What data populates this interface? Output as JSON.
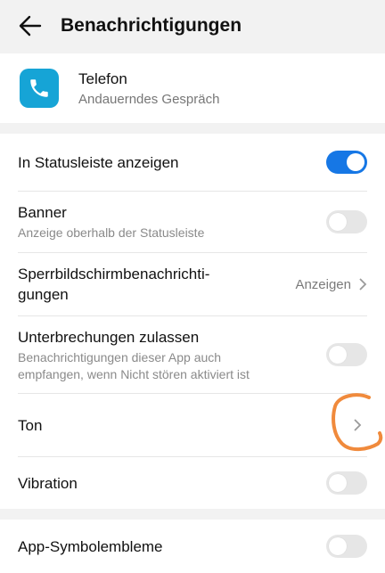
{
  "header": {
    "title": "Benachrichtigungen",
    "back_icon": "arrow-left-icon"
  },
  "app": {
    "name": "Telefon",
    "subtitle": "Andauerndes Gespräch",
    "icon": "phone-icon",
    "icon_color": "#16a4d6"
  },
  "settings": [
    {
      "label": "In Statusleiste anzeigen",
      "toggle": true
    },
    {
      "label": "Banner",
      "sub": "Anzeige oberhalb der Statusleiste",
      "toggle": false
    },
    {
      "label": "Sperrbildschirmbenachrichti-\ngungen",
      "value": "Anzeigen"
    },
    {
      "label": "Unterbrechungen zulassen",
      "sub": "Benachrichtigungen dieser App auch\nempfangen, wenn Nicht stören aktiviert ist",
      "toggle": false
    },
    {
      "label": "Ton"
    },
    {
      "label": "Vibration",
      "toggle": false
    }
  ],
  "badges": {
    "label": "App-Symbolembleme",
    "toggle": false
  },
  "colors": {
    "accent": "#1677e5",
    "annotation": "#f08a3c"
  }
}
